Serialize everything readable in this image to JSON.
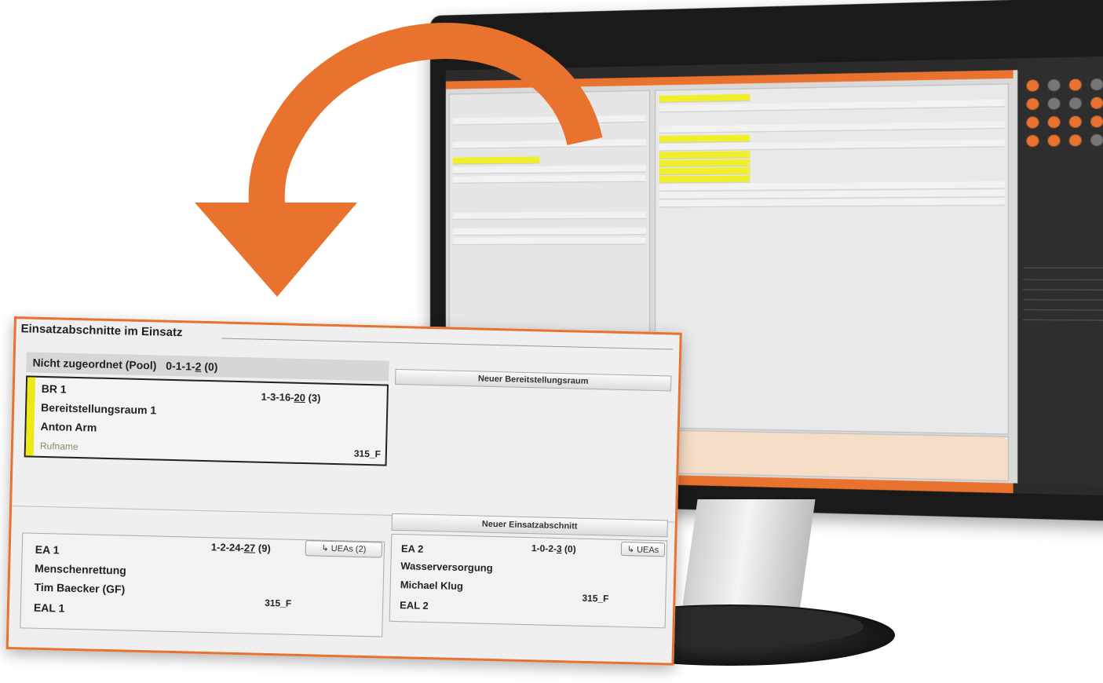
{
  "panel": {
    "title": "Einsatzabschnitte im Einsatz",
    "pool": {
      "label": "Nicht zugeordnet (Pool)",
      "code_prefix": "0-1-1-",
      "code_u": "2",
      "code_suffix": " (0)"
    },
    "btn_new_bereitstellungsraum": "Neuer Bereitstellungsraum",
    "btn_new_einsatzabschnitt": "Neuer Einsatzabschnitt",
    "br_card": {
      "id": "BR 1",
      "code_prefix": "1-3-16-",
      "code_u": "20",
      "code_suffix": " (3)",
      "name": "Bereitstellungsraum 1",
      "leader": "Anton Arm",
      "rufname_label": "Rufname",
      "number": "315_F"
    },
    "ea_cards": [
      {
        "id": "EA 1",
        "code_prefix": "1-2-24-",
        "code_u": "27",
        "code_suffix": " (9)",
        "name": "Menschenrettung",
        "leader": "Tim Baecker (GF)",
        "sub": "EAL 1",
        "number": "315_F",
        "ueas_button": "UEAs (2)"
      },
      {
        "id": "EA 2",
        "code_prefix": "1-0-2-",
        "code_u": "3",
        "code_suffix": " (0)",
        "name": "Wasserversorgung",
        "leader": "Michael Klug",
        "sub": "EAL 2",
        "number": "315_F",
        "ueas_button": "UEAs"
      }
    ]
  },
  "icons": {
    "ueas": "return-arrow-icon",
    "big_arrow": "curved-arrow-icon"
  },
  "colors": {
    "accent": "#e8722e",
    "stripe_yellow": "#ecea16",
    "monitor": "#1a1a1a"
  }
}
